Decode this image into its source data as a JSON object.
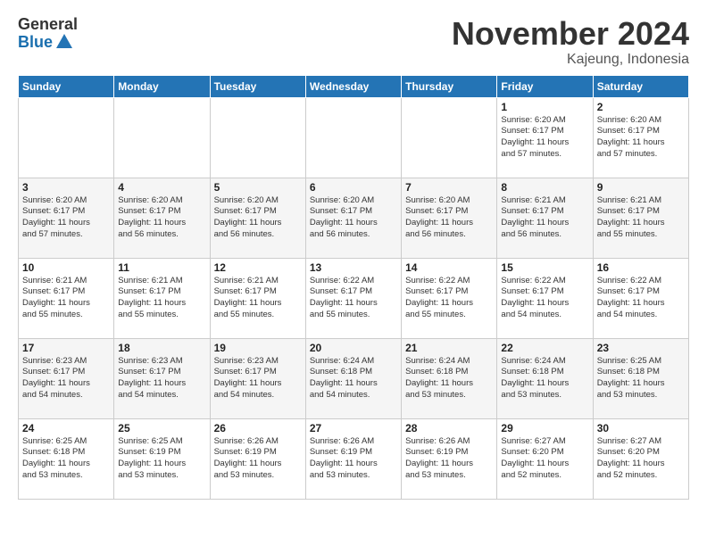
{
  "header": {
    "logo_general": "General",
    "logo_blue": "Blue",
    "month_title": "November 2024",
    "location": "Kajeung, Indonesia"
  },
  "weekdays": [
    "Sunday",
    "Monday",
    "Tuesday",
    "Wednesday",
    "Thursday",
    "Friday",
    "Saturday"
  ],
  "weeks": [
    [
      {
        "day": "",
        "info": ""
      },
      {
        "day": "",
        "info": ""
      },
      {
        "day": "",
        "info": ""
      },
      {
        "day": "",
        "info": ""
      },
      {
        "day": "",
        "info": ""
      },
      {
        "day": "1",
        "info": "Sunrise: 6:20 AM\nSunset: 6:17 PM\nDaylight: 11 hours\nand 57 minutes."
      },
      {
        "day": "2",
        "info": "Sunrise: 6:20 AM\nSunset: 6:17 PM\nDaylight: 11 hours\nand 57 minutes."
      }
    ],
    [
      {
        "day": "3",
        "info": "Sunrise: 6:20 AM\nSunset: 6:17 PM\nDaylight: 11 hours\nand 57 minutes."
      },
      {
        "day": "4",
        "info": "Sunrise: 6:20 AM\nSunset: 6:17 PM\nDaylight: 11 hours\nand 56 minutes."
      },
      {
        "day": "5",
        "info": "Sunrise: 6:20 AM\nSunset: 6:17 PM\nDaylight: 11 hours\nand 56 minutes."
      },
      {
        "day": "6",
        "info": "Sunrise: 6:20 AM\nSunset: 6:17 PM\nDaylight: 11 hours\nand 56 minutes."
      },
      {
        "day": "7",
        "info": "Sunrise: 6:20 AM\nSunset: 6:17 PM\nDaylight: 11 hours\nand 56 minutes."
      },
      {
        "day": "8",
        "info": "Sunrise: 6:21 AM\nSunset: 6:17 PM\nDaylight: 11 hours\nand 56 minutes."
      },
      {
        "day": "9",
        "info": "Sunrise: 6:21 AM\nSunset: 6:17 PM\nDaylight: 11 hours\nand 55 minutes."
      }
    ],
    [
      {
        "day": "10",
        "info": "Sunrise: 6:21 AM\nSunset: 6:17 PM\nDaylight: 11 hours\nand 55 minutes."
      },
      {
        "day": "11",
        "info": "Sunrise: 6:21 AM\nSunset: 6:17 PM\nDaylight: 11 hours\nand 55 minutes."
      },
      {
        "day": "12",
        "info": "Sunrise: 6:21 AM\nSunset: 6:17 PM\nDaylight: 11 hours\nand 55 minutes."
      },
      {
        "day": "13",
        "info": "Sunrise: 6:22 AM\nSunset: 6:17 PM\nDaylight: 11 hours\nand 55 minutes."
      },
      {
        "day": "14",
        "info": "Sunrise: 6:22 AM\nSunset: 6:17 PM\nDaylight: 11 hours\nand 55 minutes."
      },
      {
        "day": "15",
        "info": "Sunrise: 6:22 AM\nSunset: 6:17 PM\nDaylight: 11 hours\nand 54 minutes."
      },
      {
        "day": "16",
        "info": "Sunrise: 6:22 AM\nSunset: 6:17 PM\nDaylight: 11 hours\nand 54 minutes."
      }
    ],
    [
      {
        "day": "17",
        "info": "Sunrise: 6:23 AM\nSunset: 6:17 PM\nDaylight: 11 hours\nand 54 minutes."
      },
      {
        "day": "18",
        "info": "Sunrise: 6:23 AM\nSunset: 6:17 PM\nDaylight: 11 hours\nand 54 minutes."
      },
      {
        "day": "19",
        "info": "Sunrise: 6:23 AM\nSunset: 6:17 PM\nDaylight: 11 hours\nand 54 minutes."
      },
      {
        "day": "20",
        "info": "Sunrise: 6:24 AM\nSunset: 6:18 PM\nDaylight: 11 hours\nand 54 minutes."
      },
      {
        "day": "21",
        "info": "Sunrise: 6:24 AM\nSunset: 6:18 PM\nDaylight: 11 hours\nand 53 minutes."
      },
      {
        "day": "22",
        "info": "Sunrise: 6:24 AM\nSunset: 6:18 PM\nDaylight: 11 hours\nand 53 minutes."
      },
      {
        "day": "23",
        "info": "Sunrise: 6:25 AM\nSunset: 6:18 PM\nDaylight: 11 hours\nand 53 minutes."
      }
    ],
    [
      {
        "day": "24",
        "info": "Sunrise: 6:25 AM\nSunset: 6:18 PM\nDaylight: 11 hours\nand 53 minutes."
      },
      {
        "day": "25",
        "info": "Sunrise: 6:25 AM\nSunset: 6:19 PM\nDaylight: 11 hours\nand 53 minutes."
      },
      {
        "day": "26",
        "info": "Sunrise: 6:26 AM\nSunset: 6:19 PM\nDaylight: 11 hours\nand 53 minutes."
      },
      {
        "day": "27",
        "info": "Sunrise: 6:26 AM\nSunset: 6:19 PM\nDaylight: 11 hours\nand 53 minutes."
      },
      {
        "day": "28",
        "info": "Sunrise: 6:26 AM\nSunset: 6:19 PM\nDaylight: 11 hours\nand 53 minutes."
      },
      {
        "day": "29",
        "info": "Sunrise: 6:27 AM\nSunset: 6:20 PM\nDaylight: 11 hours\nand 52 minutes."
      },
      {
        "day": "30",
        "info": "Sunrise: 6:27 AM\nSunset: 6:20 PM\nDaylight: 11 hours\nand 52 minutes."
      }
    ]
  ]
}
